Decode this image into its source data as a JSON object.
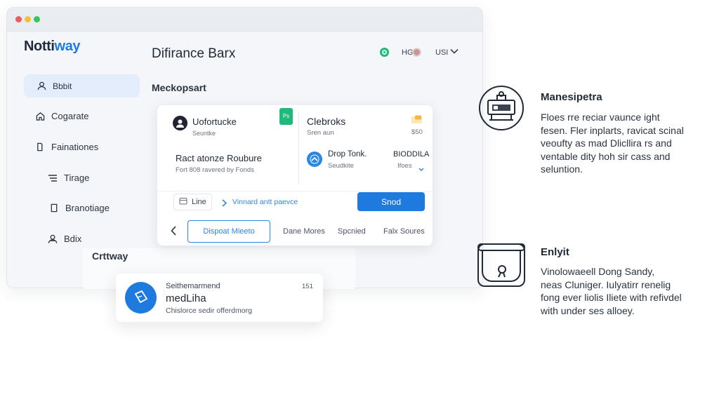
{
  "app": {
    "brand_main": "Notti",
    "brand_accent": "way"
  },
  "sidebar": {
    "items": [
      {
        "label": "Bbbit",
        "icon": "person-icon"
      },
      {
        "label": "Cogarate",
        "icon": "home-icon"
      },
      {
        "label": "Fainationes",
        "icon": "tag-icon"
      },
      {
        "label": "Tirage",
        "icon": "list-icon"
      },
      {
        "label": "Branotiage",
        "icon": "shield-icon"
      },
      {
        "label": "Bdix",
        "icon": "people-icon"
      }
    ],
    "footer_label": "Crttway"
  },
  "header": {
    "title": "Difirance Barx",
    "status_text": "HG",
    "user_text": "USI"
  },
  "main": {
    "section_title": "Meckopsart",
    "card": {
      "left": {
        "name": "Uofortucke",
        "sub": "Seuntke",
        "title": "Ract atonze Roubure",
        "desc": "Fort 808 ravered by Fonds"
      },
      "right": {
        "title": "Clebroks",
        "sub": "Sren aun",
        "amount": "$50",
        "item_title": "Drop Tonk.",
        "item_sub": "Seudkite",
        "item_code": "BIODDILA",
        "item_link": "Ifoes"
      },
      "badge_text": "Ps",
      "action_row": {
        "chip_label": "Line",
        "link_label": "Vinnard antt paevce",
        "send_label": "Snod"
      },
      "footer": {
        "dropdown_label": "Dispoat Mieeto",
        "link1": "Dane Mores",
        "link2": "Spcnied",
        "link3": "Falx Soures"
      }
    }
  },
  "popup": {
    "title": "Seithemarmend",
    "name": "medLiha",
    "desc": "Chislorce sedir offerdmorg",
    "time": "151"
  },
  "right_panel": {
    "sections": [
      {
        "title": "Manesipetra",
        "lines": [
          "Floes rre reciar vaunce ight",
          "fesen. Fler inplarts, ravicat scinal",
          "veoufty as mad Dlicllira rs and",
          "ventable dity hoh sir cass and",
          "seluntion."
        ]
      },
      {
        "title": "Enlyit",
        "lines": [
          "Vinolowaeell Dong Sandy,",
          "neas Cluniger. Iulyatirr renelig",
          "fong ever liolis Iliete with refivdel",
          "with under ses alloey."
        ]
      }
    ]
  },
  "colors": {
    "accent": "#1f7ae0",
    "status_green": "#1fb97a",
    "badge_green": "#1fb97a"
  }
}
